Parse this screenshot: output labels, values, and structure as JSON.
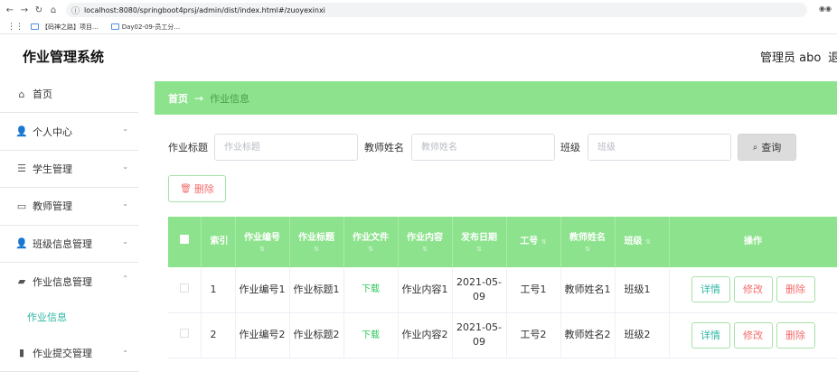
{
  "browser": {
    "url": "localhost:8080/springboot4prsj/admin/dist/index.html#/zuoyexinxi",
    "bookmarks": [
      "【码神之路】项目...",
      "Day02-09-员工分..."
    ]
  },
  "header": {
    "title": "作业管理系统",
    "admin": "管理员 abo",
    "logout": "退"
  },
  "sidebar": {
    "items": [
      {
        "label": "首页",
        "icon": "home-icon",
        "glyph": "⌂",
        "chevron": ""
      },
      {
        "label": "个人中心",
        "icon": "user-icon",
        "glyph": "👤",
        "chevron": "⌄"
      },
      {
        "label": "学生管理",
        "icon": "list-icon",
        "glyph": "☰",
        "chevron": "⌄"
      },
      {
        "label": "教师管理",
        "icon": "chat-icon",
        "glyph": "▭",
        "chevron": "⌄"
      },
      {
        "label": "班级信息管理",
        "icon": "user-icon",
        "glyph": "👤",
        "chevron": "⌄"
      },
      {
        "label": "作业信息管理",
        "icon": "briefcase-icon",
        "glyph": "▰",
        "chevron": "⌃"
      }
    ],
    "submenu": "作业信息",
    "last_item": {
      "label": "作业提交管理",
      "icon": "chart-icon",
      "glyph": "▮",
      "chevron": "⌄"
    }
  },
  "breadcrumb": {
    "home": "首页",
    "separator": "→",
    "current": "作业信息"
  },
  "search": {
    "fields": [
      {
        "label": "作业标题",
        "placeholder": "作业标题"
      },
      {
        "label": "教师姓名",
        "placeholder": "教师姓名"
      },
      {
        "label": "班级",
        "placeholder": "班级"
      }
    ],
    "button": "查询"
  },
  "actions": {
    "delete": "删除"
  },
  "table": {
    "headers": [
      "索引",
      "作业编号",
      "作业标题",
      "作业文件",
      "作业内容",
      "发布日期",
      "工号",
      "教师姓名",
      "班级",
      "操作"
    ],
    "sort_icon": "⇅",
    "rows": [
      {
        "index": "1",
        "no": "作业编号1",
        "title": "作业标题1",
        "file": "下载",
        "content": "作业内容1",
        "date": "2021-05-09",
        "job_no": "工号1",
        "teacher": "教师姓名1",
        "class": "班级1"
      },
      {
        "index": "2",
        "no": "作业编号2",
        "title": "作业标题2",
        "file": "下载",
        "content": "作业内容2",
        "date": "2021-05-09",
        "job_no": "工号2",
        "teacher": "教师姓名2",
        "class": "班级2"
      }
    ],
    "ops": {
      "detail": "详情",
      "edit": "修改",
      "delete": "删除"
    }
  },
  "colors": {
    "accent": "#8de38d",
    "teal": "#2db7a5",
    "danger": "#f56c6c"
  }
}
